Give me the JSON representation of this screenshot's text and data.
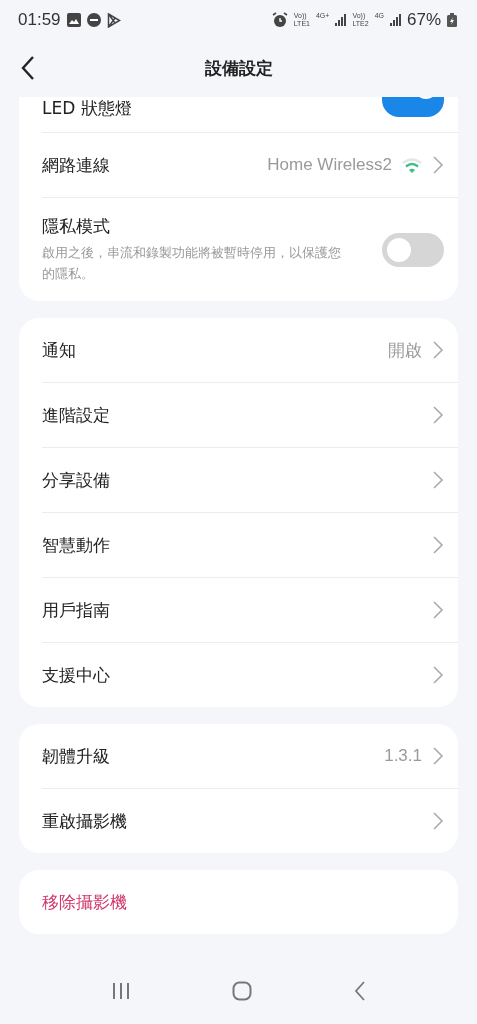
{
  "status_bar": {
    "time": "01:59",
    "sim1": {
      "volte": "Vo))",
      "lte": "LTE1",
      "network": "4G+"
    },
    "sim2": {
      "volte": "Vo))",
      "lte": "LTE2",
      "network": "4G"
    },
    "battery": "67%"
  },
  "header": {
    "title": "設備設定"
  },
  "sections": [
    {
      "rows": [
        {
          "kind": "toggle",
          "label": "LED 狀態燈",
          "on": true
        },
        {
          "kind": "wifi",
          "label": "網路連線",
          "value": "Home Wireless2"
        },
        {
          "kind": "toggle",
          "label": "隱私模式",
          "description": "啟用之後，串流和錄製功能將被暫時停用，以保護您的隱私。",
          "on": false
        }
      ]
    },
    {
      "rows": [
        {
          "kind": "link",
          "label": "通知",
          "value": "開啟"
        },
        {
          "kind": "link",
          "label": "進階設定"
        },
        {
          "kind": "link",
          "label": "分享設備"
        },
        {
          "kind": "link",
          "label": "智慧動作"
        },
        {
          "kind": "link",
          "label": "用戶指南"
        },
        {
          "kind": "link",
          "label": "支援中心"
        }
      ]
    },
    {
      "rows": [
        {
          "kind": "link",
          "label": "韌體升級",
          "value": "1.3.1"
        },
        {
          "kind": "link",
          "label": "重啟攝影機"
        }
      ]
    },
    {
      "rows": [
        {
          "kind": "danger",
          "label": "移除攝影機"
        }
      ]
    }
  ]
}
